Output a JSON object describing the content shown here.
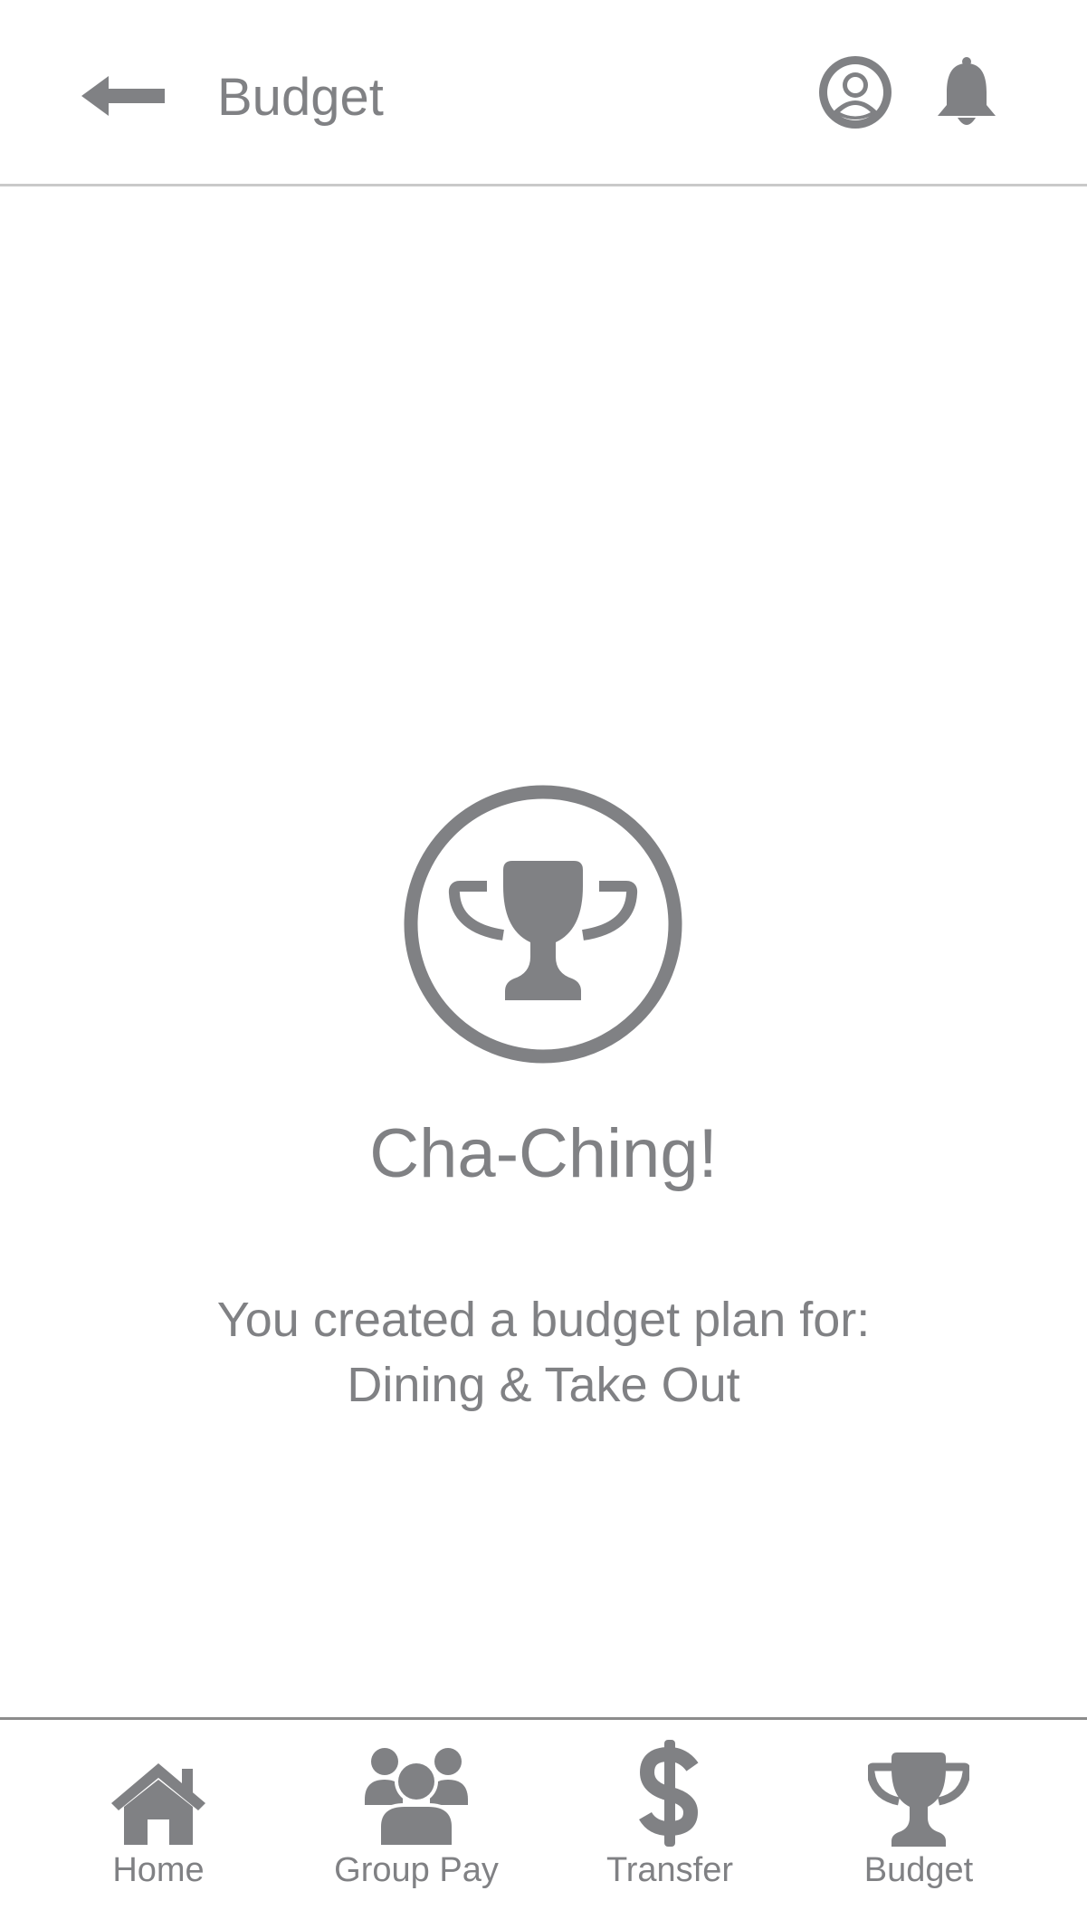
{
  "header": {
    "title": "Budget",
    "back_icon": "arrow-left-icon",
    "profile_icon": "user-circle-icon",
    "notification_icon": "bell-icon"
  },
  "success": {
    "icon": "trophy-icon",
    "title": "Cha-Ching!",
    "message_line1": "You created a budget plan for:",
    "message_line2": "Dining & Take Out"
  },
  "nav": {
    "items": [
      {
        "label": "Home",
        "icon": "home-icon"
      },
      {
        "label": "Group Pay",
        "icon": "group-icon"
      },
      {
        "label": "Transfer",
        "icon": "dollar-icon"
      },
      {
        "label": "Budget",
        "icon": "trophy-icon"
      }
    ]
  },
  "colors": {
    "primary_gray": "#808184",
    "divider_light": "#c9c9c9",
    "divider_dark": "#8c8c8c",
    "background": "#ffffff"
  }
}
